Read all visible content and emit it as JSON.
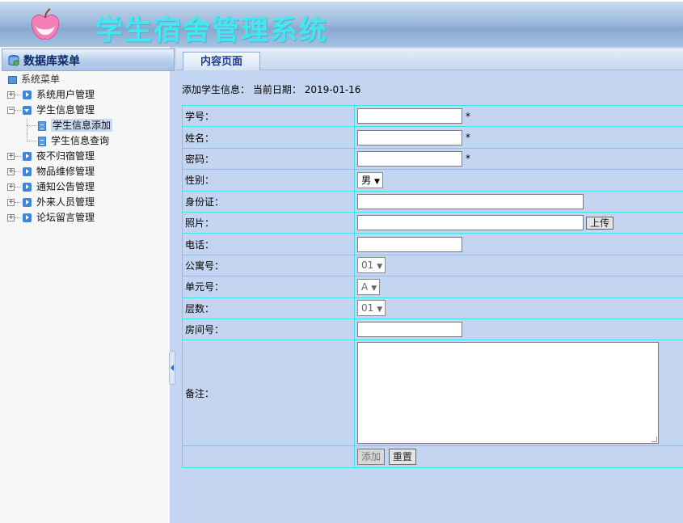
{
  "header": {
    "title": "学生宿舍管理系统"
  },
  "sidebar": {
    "title": "数据库菜单",
    "root": "系统菜单",
    "items": [
      {
        "label": "系统用户管理",
        "expanded": false
      },
      {
        "label": "学生信息管理",
        "expanded": true,
        "children": [
          "学生信息添加",
          "学生信息查询"
        ]
      },
      {
        "label": "夜不归宿管理",
        "expanded": false
      },
      {
        "label": "物品维修管理",
        "expanded": false
      },
      {
        "label": "通知公告管理",
        "expanded": false
      },
      {
        "label": "外来人员管理",
        "expanded": false
      },
      {
        "label": "论坛留言管理",
        "expanded": false
      }
    ],
    "active_child": "学生信息添加"
  },
  "tab": {
    "label": "内容页面"
  },
  "form": {
    "heading": "添加学生信息：",
    "date_label": "当前日期：",
    "date": "2019-01-16",
    "required_mark": "*",
    "fields": {
      "student_id": {
        "label": "学号：",
        "value": ""
      },
      "name": {
        "label": "姓名：",
        "value": ""
      },
      "password": {
        "label": "密码：",
        "value": ""
      },
      "gender": {
        "label": "性别：",
        "value": "男"
      },
      "id_card": {
        "label": "身份证：",
        "value": ""
      },
      "photo": {
        "label": "照片：",
        "value": "",
        "upload_label": "上传"
      },
      "phone": {
        "label": "电话：",
        "value": ""
      },
      "apartment": {
        "label": "公寓号：",
        "value": "01"
      },
      "unit": {
        "label": "单元号：",
        "value": "A"
      },
      "floor": {
        "label": "层数：",
        "value": "01"
      },
      "room": {
        "label": "房间号：",
        "value": ""
      },
      "remarks": {
        "label": "备注：",
        "value": ""
      }
    },
    "buttons": {
      "add": "添加",
      "reset": "重置"
    }
  }
}
